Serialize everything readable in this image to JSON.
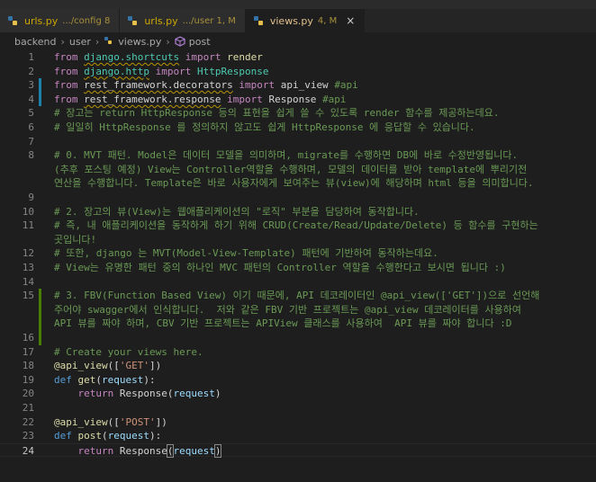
{
  "top_strip": "               ",
  "tabs": [
    {
      "icon": "python-file-icon",
      "name": "urls.py",
      "detail": ".../config 8",
      "state": "inactive-warn"
    },
    {
      "icon": "python-file-icon",
      "name": "urls.py",
      "detail": ".../user 1, M",
      "state": "inactive-warn"
    },
    {
      "icon": "python-file-icon",
      "name": "views.py",
      "detail": "4, M",
      "state": "active",
      "close": "×"
    }
  ],
  "breadcrumb": [
    "backend",
    "user",
    "views.py",
    "post"
  ],
  "colors": {
    "editor_bg": "#1e1e1e",
    "keyword": "#c586c0",
    "comment": "#6a9955",
    "module": "#4ec9b0",
    "string": "#ce9178",
    "function": "#dcdcaa",
    "variable": "#9cdcfe"
  },
  "lines": [
    {
      "n": "1",
      "mark": "",
      "tokens": [
        [
          "kw",
          "from"
        ],
        [
          "pl",
          " "
        ],
        [
          "mod sq",
          "django.shortcuts"
        ],
        [
          "pl",
          " "
        ],
        [
          "kw",
          "import"
        ],
        [
          "pl",
          " "
        ],
        [
          "fn",
          "render"
        ]
      ]
    },
    {
      "n": "2",
      "mark": "",
      "tokens": [
        [
          "kw",
          "from"
        ],
        [
          "pl",
          " "
        ],
        [
          "mod sq",
          "django.http"
        ],
        [
          "pl",
          " "
        ],
        [
          "kw",
          "import"
        ],
        [
          "pl",
          " "
        ],
        [
          "cls",
          "HttpResponse"
        ]
      ]
    },
    {
      "n": "3",
      "mark": "mod",
      "tokens": [
        [
          "kw",
          "from"
        ],
        [
          "pl",
          " "
        ],
        [
          "pl sq",
          "rest_framework.decorators"
        ],
        [
          "pl",
          " "
        ],
        [
          "kw",
          "import"
        ],
        [
          "pl",
          " "
        ],
        [
          "pl",
          "api_view"
        ],
        [
          "pl",
          " "
        ],
        [
          "cm",
          "#api"
        ]
      ]
    },
    {
      "n": "4",
      "mark": "mod",
      "tokens": [
        [
          "kw",
          "from"
        ],
        [
          "pl",
          " "
        ],
        [
          "pl sq",
          "rest_framework.response"
        ],
        [
          "pl",
          " "
        ],
        [
          "kw",
          "import"
        ],
        [
          "pl",
          " "
        ],
        [
          "pl",
          "Response"
        ],
        [
          "pl",
          " "
        ],
        [
          "cm",
          "#api"
        ]
      ]
    },
    {
      "n": "5",
      "mark": "",
      "tokens": [
        [
          "cm",
          "# 장고는 return HttpResponse 등의 표현을 쉽게 쓸 수 있도록 render 함수를 제공하는데요."
        ]
      ]
    },
    {
      "n": "6",
      "mark": "",
      "tokens": [
        [
          "cm",
          "# 일일히 HttpResponse 를 정의하지 않고도 쉽게 HttpResponse 에 응답할 수 있습니다."
        ]
      ]
    },
    {
      "n": "7",
      "mark": "",
      "tokens": []
    },
    {
      "n": "8",
      "mark": "",
      "tokens": [
        [
          "cm",
          "# 0. MVT 패턴. Model은 데이터 모델을 의미하며, migrate를 수행하면 DB에 바로 수정반영됩니다."
        ]
      ]
    },
    {
      "n": "",
      "mark": "",
      "tokens": [
        [
          "cm",
          "(추후 포스팅 예정) View는 Controller역할을 수행하며, 모델의 데이터를 받아 template에 뿌리기전"
        ]
      ]
    },
    {
      "n": "",
      "mark": "",
      "tokens": [
        [
          "cm",
          "연산을 수행합니다. Template은 바로 사용자에게 보여주는 뷰(view)에 해당하며 html 등을 의미합니다."
        ]
      ]
    },
    {
      "n": "9",
      "mark": "",
      "tokens": []
    },
    {
      "n": "10",
      "mark": "",
      "tokens": [
        [
          "cm",
          "# 2. 장고의 뷰(View)는 웹애플리케이션의 \"로직\" 부분을 담당하여 동작합니다."
        ]
      ]
    },
    {
      "n": "11",
      "mark": "",
      "tokens": [
        [
          "cm",
          "# 즉, 내 애플리케이션을 동작하게 하기 위해 CRUD(Create/Read/Update/Delete) 등 함수를 구현하는"
        ]
      ]
    },
    {
      "n": "",
      "mark": "",
      "tokens": [
        [
          "cm",
          "곳입니다!"
        ]
      ]
    },
    {
      "n": "12",
      "mark": "",
      "tokens": [
        [
          "cm",
          "# 또한, django 는 MVT(Model-View-Template) 패턴에 기반하여 동작하는데요."
        ]
      ]
    },
    {
      "n": "13",
      "mark": "",
      "tokens": [
        [
          "cm",
          "# View는 유명한 패턴 중의 하나인 MVC 패턴의 Controller 역할을 수행한다고 보시면 됩니다 :)"
        ]
      ]
    },
    {
      "n": "14",
      "mark": "",
      "tokens": []
    },
    {
      "n": "15",
      "mark": "add",
      "tokens": [
        [
          "cm",
          "# 3. FBV(Function Based View) 이기 때문에, API 데코레이터인 @api_view(['GET'])으로 선언해"
        ]
      ]
    },
    {
      "n": "",
      "mark": "add",
      "tokens": [
        [
          "cm",
          "주어야 swagger에서 인식합니다.  저와 같은 FBV 기반 프로젝트는 @api_view 데코레이터를 사용하여"
        ]
      ]
    },
    {
      "n": "",
      "mark": "add",
      "tokens": [
        [
          "cm",
          "API 뷰를 짜야 하며, CBV 기반 프로젝트는 APIView 클래스를 사용하여  API 뷰를 짜야 합니다 :D"
        ]
      ]
    },
    {
      "n": "16",
      "mark": "add",
      "tokens": []
    },
    {
      "n": "17",
      "mark": "",
      "tokens": [
        [
          "cm",
          "# Create your views here."
        ]
      ]
    },
    {
      "n": "18",
      "mark": "",
      "tokens": [
        [
          "dec",
          "@api_view"
        ],
        [
          "pl",
          "(["
        ],
        [
          "str",
          "'GET'"
        ],
        [
          "pl",
          "])"
        ]
      ]
    },
    {
      "n": "19",
      "mark": "",
      "tokens": [
        [
          "kw2",
          "def"
        ],
        [
          "pl",
          " "
        ],
        [
          "fn",
          "get"
        ],
        [
          "pl",
          "("
        ],
        [
          "var",
          "request"
        ],
        [
          "pl",
          "):"
        ]
      ]
    },
    {
      "n": "20",
      "mark": "",
      "tokens": [
        [
          "pl",
          "    "
        ],
        [
          "kw",
          "return"
        ],
        [
          "pl",
          " "
        ],
        [
          "pl",
          "Response"
        ],
        [
          "pl",
          "("
        ],
        [
          "var",
          "request"
        ],
        [
          "pl",
          ")"
        ]
      ]
    },
    {
      "n": "21",
      "mark": "",
      "tokens": []
    },
    {
      "n": "22",
      "mark": "",
      "tokens": [
        [
          "dec",
          "@api_view"
        ],
        [
          "pl",
          "(["
        ],
        [
          "str",
          "'POST'"
        ],
        [
          "pl",
          "])"
        ]
      ]
    },
    {
      "n": "23",
      "mark": "",
      "tokens": [
        [
          "kw2",
          "def"
        ],
        [
          "pl",
          " "
        ],
        [
          "fn",
          "post"
        ],
        [
          "pl",
          "("
        ],
        [
          "var",
          "request"
        ],
        [
          "pl",
          "):"
        ]
      ]
    },
    {
      "n": "24",
      "mark": "",
      "current": true,
      "tokens": [
        [
          "pl",
          "    "
        ],
        [
          "kw",
          "return"
        ],
        [
          "pl",
          " "
        ],
        [
          "pl",
          "Response"
        ],
        [
          "pl bracket-box",
          "("
        ],
        [
          "var",
          "request"
        ],
        [
          "pl bracket-box",
          ")"
        ]
      ]
    }
  ]
}
